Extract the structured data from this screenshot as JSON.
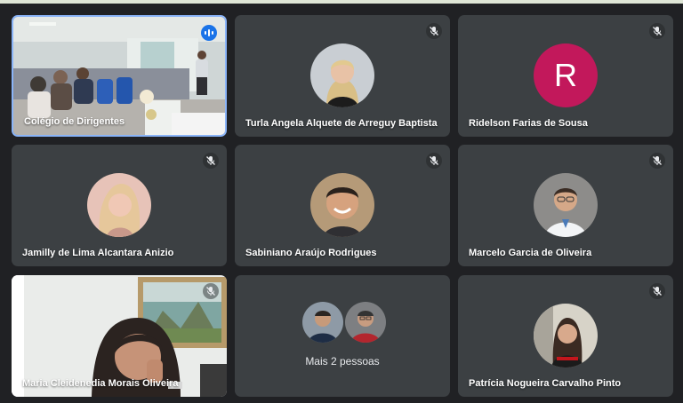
{
  "participants": [
    {
      "name": "Colégio de Dirigentes",
      "speaking": true
    },
    {
      "name": "Turla Angela Alquete de Arreguy Baptista",
      "muted": true
    },
    {
      "name": "Ridelson Farias de Sousa",
      "muted": true,
      "initial": "R",
      "color": "#c2185b"
    },
    {
      "name": "Jamilly de Lima Alcantara Anizio",
      "muted": true
    },
    {
      "name": "Sabiniano Araújo Rodrigues",
      "muted": true
    },
    {
      "name": "Marcelo Garcia de Oliveira",
      "muted": true
    },
    {
      "name": "Maria Cleidenedia Morais Oliveira",
      "muted": true
    },
    {
      "name": "Patrícia Nogueira Carvalho Pinto",
      "muted": true
    }
  ],
  "more": {
    "label": "Mais 2 pessoas"
  },
  "icons": {
    "muted": "mic-off-icon",
    "speaking": "audio-level-icon"
  }
}
